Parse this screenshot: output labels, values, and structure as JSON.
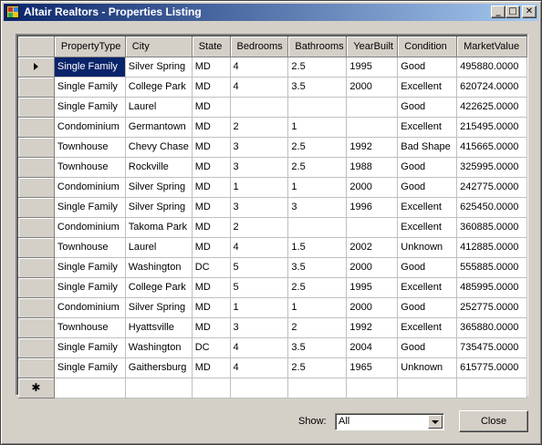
{
  "window": {
    "title": "Altair Realtors - Properties Listing",
    "controls": {
      "minimize": "_",
      "maximize": "□",
      "close": "✕"
    }
  },
  "grid": {
    "columns": [
      "PropertyType",
      "City",
      "State",
      "Bedrooms",
      "Bathrooms",
      "YearBuilt",
      "Condition",
      "MarketValue"
    ],
    "selected_row": 0,
    "new_row_marker": "✱",
    "rows": [
      [
        "Single Family",
        "Silver Spring",
        "MD",
        "4",
        "2.5",
        "1995",
        "Good",
        "495880.0000"
      ],
      [
        "Single Family",
        "College Park",
        "MD",
        "4",
        "3.5",
        "2000",
        "Excellent",
        "620724.0000"
      ],
      [
        "Single Family",
        "Laurel",
        "MD",
        "",
        "",
        "",
        "Good",
        "422625.0000"
      ],
      [
        "Condominium",
        "Germantown",
        "MD",
        "2",
        "1",
        "",
        "Excellent",
        "215495.0000"
      ],
      [
        "Townhouse",
        "Chevy Chase",
        "MD",
        "3",
        "2.5",
        "1992",
        "Bad Shape",
        "415665.0000"
      ],
      [
        "Townhouse",
        "Rockville",
        "MD",
        "3",
        "2.5",
        "1988",
        "Good",
        "325995.0000"
      ],
      [
        "Condominium",
        "Silver Spring",
        "MD",
        "1",
        "1",
        "2000",
        "Good",
        "242775.0000"
      ],
      [
        "Single Family",
        "Silver Spring",
        "MD",
        "3",
        "3",
        "1996",
        "Excellent",
        "625450.0000"
      ],
      [
        "Condominium",
        "Takoma Park",
        "MD",
        "2",
        "",
        "",
        "Excellent",
        "360885.0000"
      ],
      [
        "Townhouse",
        "Laurel",
        "MD",
        "4",
        "1.5",
        "2002",
        "Unknown",
        "412885.0000"
      ],
      [
        "Single Family",
        "Washington",
        "DC",
        "5",
        "3.5",
        "2000",
        "Good",
        "555885.0000"
      ],
      [
        "Single Family",
        "College Park",
        "MD",
        "5",
        "2.5",
        "1995",
        "Excellent",
        "485995.0000"
      ],
      [
        "Condominium",
        "Silver Spring",
        "MD",
        "1",
        "1",
        "2000",
        "Good",
        "252775.0000"
      ],
      [
        "Townhouse",
        "Hyattsville",
        "MD",
        "3",
        "2",
        "1992",
        "Excellent",
        "365880.0000"
      ],
      [
        "Single Family",
        "Washington",
        "DC",
        "4",
        "3.5",
        "2004",
        "Good",
        "735475.0000"
      ],
      [
        "Single Family",
        "Gaithersburg",
        "MD",
        "4",
        "2.5",
        "1965",
        "Unknown",
        "615775.0000"
      ]
    ]
  },
  "footer": {
    "show_label": "Show:",
    "show_value": "All",
    "close_label": "Close"
  }
}
